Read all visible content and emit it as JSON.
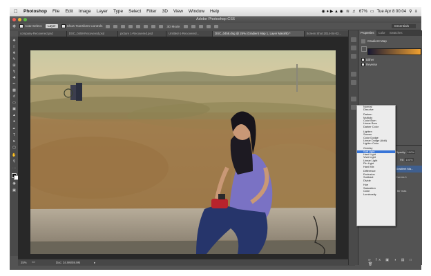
{
  "menubar": {
    "app_name": "Photoshop",
    "menus": [
      "File",
      "Edit",
      "Image",
      "Layer",
      "Type",
      "Select",
      "Filter",
      "3D",
      "View",
      "Window",
      "Help"
    ],
    "battery": "67%",
    "clock": "Tue Apr 8  00:04"
  },
  "window": {
    "title": "Adobe Photoshop CS6"
  },
  "options": {
    "auto_select": "Auto-Select:",
    "auto_select_value": "Layer",
    "show_transform": "Show Transform Controls",
    "mode_3d": "3D Mode:",
    "workspace": "Essentials"
  },
  "tabs": [
    "company-Recovered.psd",
    "DSC_0458-Recovered.psd",
    "picture 1-Recovered.psd",
    "Untitled-1-Recovered...",
    "DSC_0458.dng @ 25% (Gradient Map 1, Layer Mask/8) *",
    "Screen Shot 2014-04-02..."
  ],
  "status": {
    "zoom": "25%",
    "doc": "Doc: 34.9M/59.9M"
  },
  "panel": {
    "tab_properties": "Properties",
    "tab_color": "Color",
    "tab_swatches": "Swatches",
    "gradient_map_label": "Gradient Map",
    "dither_label": "Dither",
    "reverse_label": "Reverse"
  },
  "layers_panel": {
    "opacity_label": "Opacity:",
    "opacity_value": "100%",
    "fill_label": "Fill:",
    "fill_value": "100%",
    "layer_gradient": "Gradient Ma...",
    "layer_curves": "Curves 1",
    "layer_mask_note": "ter mas"
  },
  "blend_modes": {
    "groups": [
      [
        "Normal",
        "Dissolve"
      ],
      [
        "Darken",
        "Multiply",
        "Color Burn",
        "Linear Burn",
        "Darker Color"
      ],
      [
        "Lighten",
        "Screen",
        "Color Dodge",
        "Linear Dodge (Add)",
        "Lighter Color"
      ],
      [
        "Overlay",
        "Soft Light",
        "Hard Light",
        "Vivid Light",
        "Linear Light",
        "Pin Light",
        "Hard Mix"
      ],
      [
        "Difference",
        "Exclusion",
        "Subtract",
        "Divide"
      ],
      [
        "Hue",
        "Saturation",
        "Color",
        "Luminosity"
      ]
    ],
    "selected": "Soft Light"
  },
  "colors": {
    "selection": "#3875d7",
    "gradient_start": "#1a1a33",
    "gradient_end": "#f0a030"
  }
}
